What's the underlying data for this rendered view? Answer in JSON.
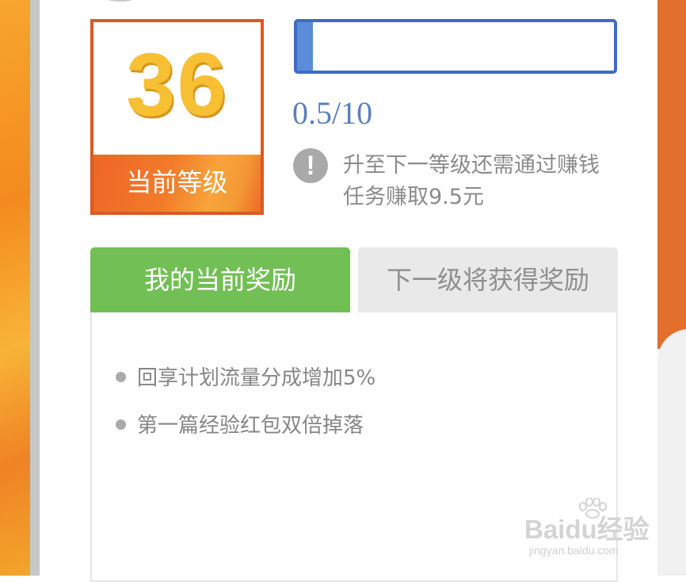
{
  "level": {
    "number": "36",
    "label": "当前等级"
  },
  "progress": {
    "text": "0.5/10",
    "fraction": 0.05
  },
  "notice": {
    "icon": "exclamation-icon",
    "text": "升至下一等级还需通过赚钱任务赚取9.5元"
  },
  "tabs": [
    {
      "label": "我的当前奖励",
      "active": true
    },
    {
      "label": "下一级将获得奖励",
      "active": false
    }
  ],
  "rewards": [
    "回享计划流量分成增加5%",
    "第一篇经验红包双倍掉落"
  ],
  "watermark": {
    "logo": "Baidu经验",
    "url": "jingyan.baidu.com"
  },
  "colors": {
    "accent_orange": "#db5a20",
    "level_gold": "#f7bf32",
    "progress_blue": "#3e6cc4",
    "tab_green": "#72bf55"
  }
}
